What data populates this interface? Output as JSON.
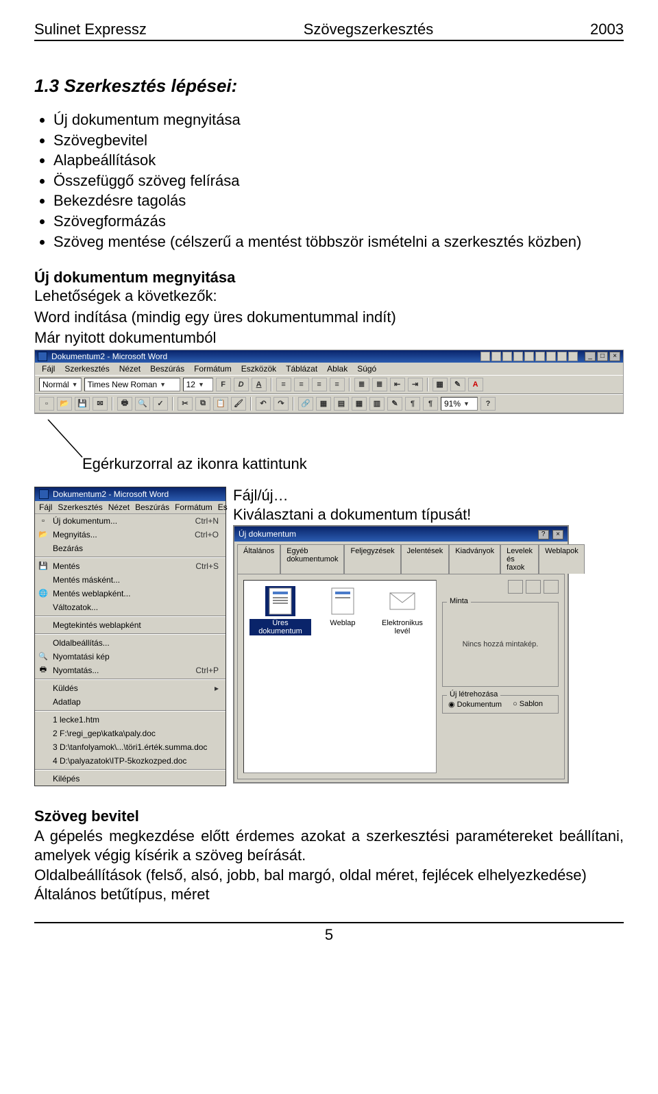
{
  "header": {
    "left": "Sulinet Expressz",
    "center": "Szövegszerkesztés",
    "right": "2003"
  },
  "section_title": "1.3 Szerkesztés lépései:",
  "bullets": [
    "Új dokumentum megnyitása",
    "Szövegbevitel",
    "Alapbeállítások",
    "Összefüggő szöveg felírása",
    "Bekezdésre tagolás",
    "Szövegformázás",
    "Szöveg mentése (célszerű a mentést többször ismételni a szerkesztés közben)"
  ],
  "sub1_title": "Új dokumentum megnyitása",
  "sub1_line1": "Lehetőségek a következők:",
  "sub1_line2": "Word indítása (mindig egy üres dokumentummal indít)",
  "sub1_line3": "Már nyitott dokumentumból",
  "word_titlebar": "Dokumentum2 - Microsoft Word",
  "menubar": [
    "Fájl",
    "Szerkesztés",
    "Nézet",
    "Beszúrás",
    "Formátum",
    "Eszközök",
    "Táblázat",
    "Ablak",
    "Súgó"
  ],
  "fmt_style": "Normál",
  "fmt_font": "Times New Roman",
  "fmt_size": "12",
  "zoom": "91%",
  "caption1": "Egérkurzorral az ikonra kattintunk",
  "filemenu_title": "Dokumentum2 - Microsoft Word",
  "filemenu_bar": [
    "Fájl",
    "Szerkesztés",
    "Nézet",
    "Beszúrás",
    "Formátum",
    "Es"
  ],
  "filemenu_items": [
    {
      "label": "Új dokumentum...",
      "shortcut": "Ctrl+N",
      "icon": "new"
    },
    {
      "label": "Megnyitás...",
      "shortcut": "Ctrl+O",
      "icon": "open"
    },
    {
      "label": "Bezárás",
      "shortcut": "",
      "icon": ""
    },
    {
      "sep": true
    },
    {
      "label": "Mentés",
      "shortcut": "Ctrl+S",
      "icon": "save"
    },
    {
      "label": "Mentés másként...",
      "shortcut": "",
      "icon": ""
    },
    {
      "label": "Mentés weblapként...",
      "shortcut": "",
      "icon": "saveweb"
    },
    {
      "label": "Változatok...",
      "shortcut": "",
      "icon": ""
    },
    {
      "sep": true
    },
    {
      "label": "Megtekintés weblapként",
      "shortcut": "",
      "icon": ""
    },
    {
      "sep": true
    },
    {
      "label": "Oldalbeállítás...",
      "shortcut": "",
      "icon": ""
    },
    {
      "label": "Nyomtatási kép",
      "shortcut": "",
      "icon": "preview"
    },
    {
      "label": "Nyomtatás...",
      "shortcut": "Ctrl+P",
      "icon": "print"
    },
    {
      "sep": true
    },
    {
      "label": "Küldés",
      "shortcut": "",
      "icon": "",
      "arrow": true
    },
    {
      "label": "Adatlap",
      "shortcut": "",
      "icon": ""
    },
    {
      "sep": true
    },
    {
      "label": "1 lecke1.htm",
      "shortcut": "",
      "icon": ""
    },
    {
      "label": "2 F:\\regi_gep\\katka\\paly.doc",
      "shortcut": "",
      "icon": ""
    },
    {
      "label": "3 D:\\tanfolyamok\\...\\töri1.érték.summa.doc",
      "shortcut": "",
      "icon": ""
    },
    {
      "label": "4 D:\\palyazatok\\ITP-5kozkozped.doc",
      "shortcut": "",
      "icon": ""
    },
    {
      "sep": true
    },
    {
      "label": "Kilépés",
      "shortcut": "",
      "icon": ""
    }
  ],
  "right_lbl1": "Fájl/új…",
  "right_lbl2": "Kiválasztani a dokumentum típusát!",
  "dialog_title": "Új dokumentum",
  "dialog_tabs": [
    "Általános",
    "Egyéb dokumentumok",
    "Feljegyzések",
    "Jelentések",
    "Kiadványok",
    "Levelek és faxok",
    "Weblapok"
  ],
  "templates": [
    {
      "name": "Üres dokumentum",
      "sel": true,
      "icon": "word"
    },
    {
      "name": "Weblap",
      "sel": false,
      "icon": "word"
    },
    {
      "name": "Elektronikus levél",
      "sel": false,
      "icon": "mail"
    }
  ],
  "preview_legend": "Minta",
  "preview_text": "Nincs hozzá mintakép.",
  "create_legend": "Új létrehozása",
  "radio_doc": "Dokumentum",
  "radio_tpl": "Sablon",
  "body_heading": "Szöveg bevitel",
  "body_p1": "A gépelés megkezdése előtt érdemes azokat a szerkesztési paramétereket beállítani, amelyek végig kísérik a szöveg beírását.",
  "body_p2": "Oldalbeállítások (felső, alsó, jobb, bal margó, oldal méret, fejlécek elhelyezkedése)",
  "body_p3": "Általános betűtípus, méret",
  "page_num": "5"
}
